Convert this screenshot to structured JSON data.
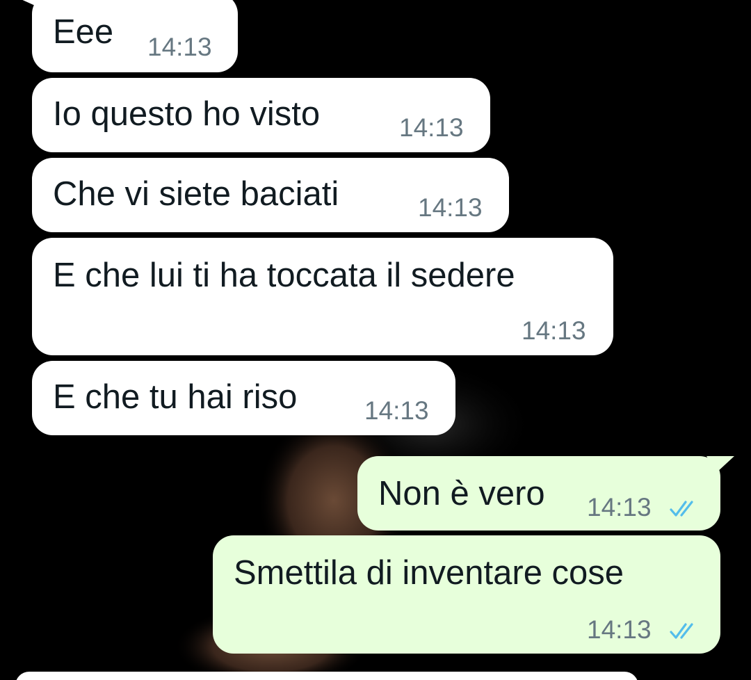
{
  "colors": {
    "background": "#000000",
    "incoming_bubble": "#ffffff",
    "outgoing_bubble": "#e7ffdb",
    "text": "#111b21",
    "timestamp": "#667781",
    "read_ticks": "#53bdeb"
  },
  "messages": [
    {
      "direction": "incoming",
      "text": "Eee",
      "time": "14:13"
    },
    {
      "direction": "incoming",
      "text": "Io questo ho visto",
      "time": "14:13"
    },
    {
      "direction": "incoming",
      "text": "Che vi siete baciati",
      "time": "14:13"
    },
    {
      "direction": "incoming",
      "text": "E che lui ti ha toccata il sedere",
      "time": "14:13"
    },
    {
      "direction": "incoming",
      "text": "E che tu hai riso",
      "time": "14:13"
    },
    {
      "direction": "outgoing",
      "text": "Non è vero",
      "time": "14:13",
      "status_icon": "double-check-read-icon"
    },
    {
      "direction": "outgoing",
      "text": "Smettila di inventare cose",
      "time": "14:13",
      "status_icon": "double-check-read-icon"
    }
  ]
}
